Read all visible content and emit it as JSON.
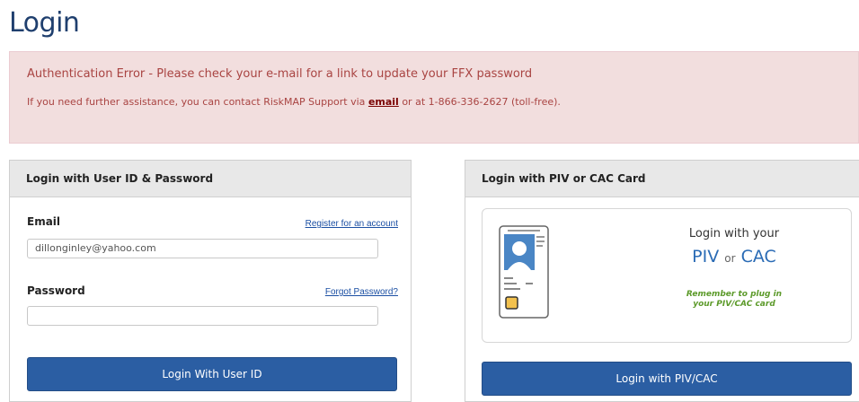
{
  "page": {
    "title": "Login"
  },
  "alert": {
    "title": "Authentication Error - Please check your e-mail for a link to update your FFX password",
    "help_prefix": "If you need further assistance, you can contact RiskMAP Support via ",
    "help_link": "email",
    "help_suffix": " or at 1-866-336-2627 (toll-free)."
  },
  "user_login": {
    "heading": "Login with User ID & Password",
    "email_label": "Email",
    "register_link": "Register for an account",
    "email_value": "dillonginley@yahoo.com",
    "password_label": "Password",
    "forgot_link": "Forgot Password?",
    "password_value": "",
    "button_label": "Login With User ID"
  },
  "piv_login": {
    "heading": "Login with PIV or CAC Card",
    "login_with": "Login with your",
    "piv": "PIV",
    "or": "or",
    "cac": "CAC",
    "reminder_line1": "Remember to plug in",
    "reminder_line2": "your PIV/CAC card",
    "button_label": "Login with PIV/CAC"
  },
  "colors": {
    "title": "#1f3f6e",
    "alert_bg": "#f2dede",
    "alert_text": "#a94442",
    "button": "#2b5ea3",
    "link": "#1b4fa3",
    "piv_cac": "#2a6bb5",
    "reminder": "#5c9a2a"
  },
  "icons": {
    "card": "id-card-icon"
  }
}
